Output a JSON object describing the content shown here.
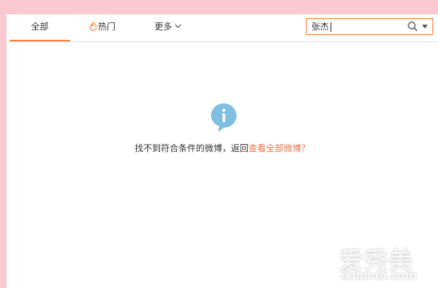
{
  "tabs": {
    "all_label": "全部",
    "hot_label": "热门",
    "more_label": "更多"
  },
  "search": {
    "value": "张杰"
  },
  "empty": {
    "message": "找不到符合条件的微博，返回",
    "link": "查看全部微博？"
  },
  "watermark": {
    "cn": "爱秀美",
    "en": "ixiumei.com"
  },
  "colors": {
    "accent": "#ff8140",
    "link": "#eb7350",
    "info": "#7fbfe0",
    "background": "#f9c8d0"
  },
  "icons": [
    "fire-icon",
    "chevron-down-icon",
    "search-icon",
    "dropdown-arrow-icon",
    "info-icon"
  ]
}
